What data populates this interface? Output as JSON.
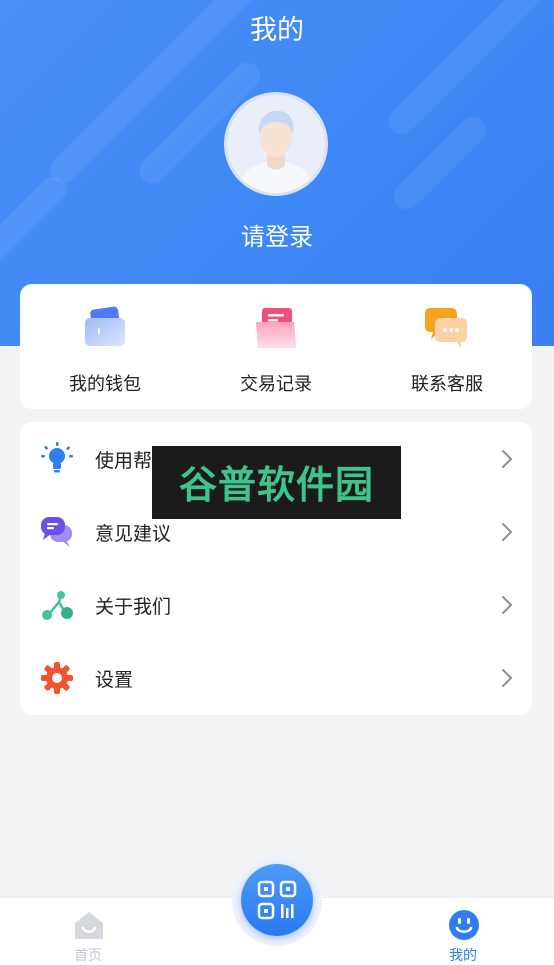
{
  "header": {
    "title": "我的",
    "login_prompt": "请登录"
  },
  "quick_actions": [
    {
      "label": "我的钱包",
      "icon": "wallet-icon"
    },
    {
      "label": "交易记录",
      "icon": "transaction-records-icon"
    },
    {
      "label": "联系客服",
      "icon": "customer-service-icon"
    }
  ],
  "menu": [
    {
      "label": "使用帮助",
      "icon": "lightbulb-icon"
    },
    {
      "label": "意见建议",
      "icon": "feedback-chat-icon"
    },
    {
      "label": "关于我们",
      "icon": "share-nodes-icon"
    },
    {
      "label": "设置",
      "icon": "gear-icon"
    }
  ],
  "watermark": {
    "text": "谷普软件园"
  },
  "tabbar": {
    "home_label": "首页",
    "mine_label": "我的",
    "scan_icon": "qr-scan-icon"
  },
  "colors": {
    "primary": "#3d87f5",
    "tab_inactive": "#c2c6ce",
    "tab_active": "#2f7ef0",
    "watermark_text": "#3fc58b"
  }
}
